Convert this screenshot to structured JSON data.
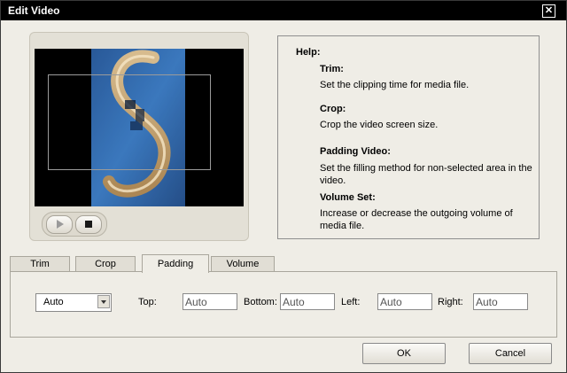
{
  "window": {
    "title": "Edit Video",
    "close_glyph": "✕"
  },
  "help": {
    "heading": "Help:",
    "items": [
      {
        "title": "Trim:",
        "text": "Set the clipping time for media file."
      },
      {
        "title": "Crop:",
        "text": "Crop the video screen size."
      },
      {
        "title": "Padding Video:",
        "text": "Set the filling method for non-selected area in the video."
      },
      {
        "title": "Volume Set:",
        "text": "Increase or decrease the outgoing volume of media file."
      }
    ]
  },
  "player": {
    "play_icon": "play-icon",
    "stop_icon": "stop-icon"
  },
  "tabs": [
    {
      "label": "Trim",
      "active": false
    },
    {
      "label": "Crop",
      "active": false
    },
    {
      "label": "Padding",
      "active": true
    },
    {
      "label": "Volume",
      "active": false
    }
  ],
  "padding": {
    "mode_value": "Auto",
    "top_label": "Top:",
    "top_value": "Auto",
    "bottom_label": "Bottom:",
    "bottom_value": "Auto",
    "left_label": "Left:",
    "left_value": "Auto",
    "right_label": "Right:",
    "right_value": "Auto"
  },
  "buttons": {
    "ok": "OK",
    "cancel": "Cancel"
  },
  "colors": {
    "titlebar": "#000000",
    "dialog_bg": "#efede6",
    "video_bg": "#000000"
  }
}
